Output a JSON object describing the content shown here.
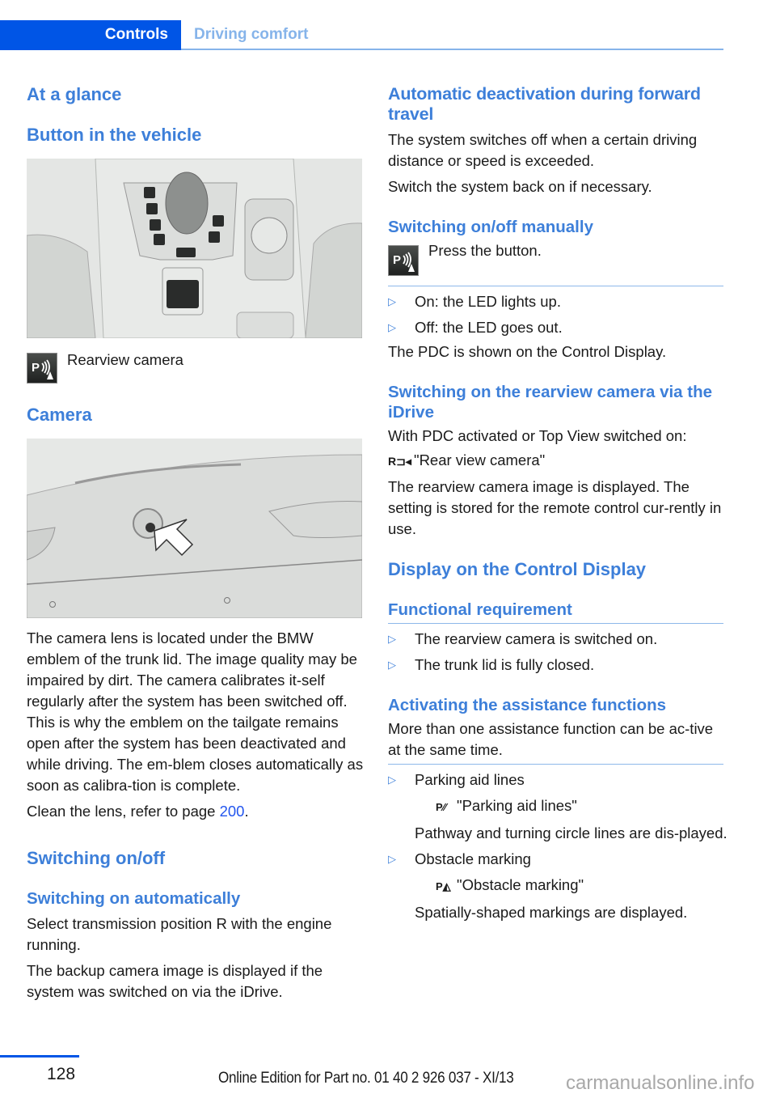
{
  "header": {
    "tab_active": "Controls",
    "tab_inactive": "Driving comfort"
  },
  "left": {
    "h_at_glance": "At a glance",
    "h_button": "Button in the vehicle",
    "icon_label": "Rearview camera",
    "h_camera": "Camera",
    "camera_text": "The camera lens is located under the BMW emblem of the trunk lid. The image quality may be impaired by dirt. The camera calibrates it-self regularly after the system has been switched off. This is why the emblem on the tailgate remains open after the system has been deactivated and while driving. The em-blem closes automatically as soon as calibra-tion is complete.",
    "clean_prefix": "Clean the lens, refer to page ",
    "clean_link": "200",
    "clean_suffix": ".",
    "h_switching": "Switching on/off",
    "h_auto": "Switching on automatically",
    "auto_text1": "Select transmission position R with the engine running.",
    "auto_text2": "The backup camera image is displayed if the system was switched on via the iDrive."
  },
  "right": {
    "h_deact": "Automatic deactivation during forward travel",
    "deact_text1": "The system switches off when a certain driving distance or speed is exceeded.",
    "deact_text2": "Switch the system back on if necessary.",
    "h_manual": "Switching on/off manually",
    "press": "Press the button.",
    "bullets1": [
      "On: the LED lights up.",
      "Off: the LED goes out."
    ],
    "pdc_text": "The PDC is shown on the Control Display.",
    "h_idrive": "Switching on the rearview camera via the iDrive",
    "idrive_text": "With PDC activated or Top View switched on:",
    "menu_rear": "\"Rear view camera\"",
    "rear_text": "The rearview camera image is displayed. The setting is stored for the remote control cur-rently in use.",
    "h_display": "Display on the Control Display",
    "h_func": "Functional requirement",
    "bullets2": [
      "The rearview camera is switched on.",
      "The trunk lid is fully closed."
    ],
    "h_assist": "Activating the assistance functions",
    "assist_text": "More than one assistance function can be ac-tive at the same time.",
    "assist_items": [
      {
        "label": "Parking aid lines",
        "menu": "\"Parking aid lines\"",
        "desc": "Pathway and turning circle lines are dis-played."
      },
      {
        "label": "Obstacle marking",
        "menu": "\"Obstacle marking\"",
        "desc": "Spatially-shaped markings are displayed."
      }
    ]
  },
  "footer": {
    "page_number": "128",
    "edition": "Online Edition for Part no. 01 40 2 926 037 - XI/13",
    "watermark": "carmanualsonline.info"
  }
}
